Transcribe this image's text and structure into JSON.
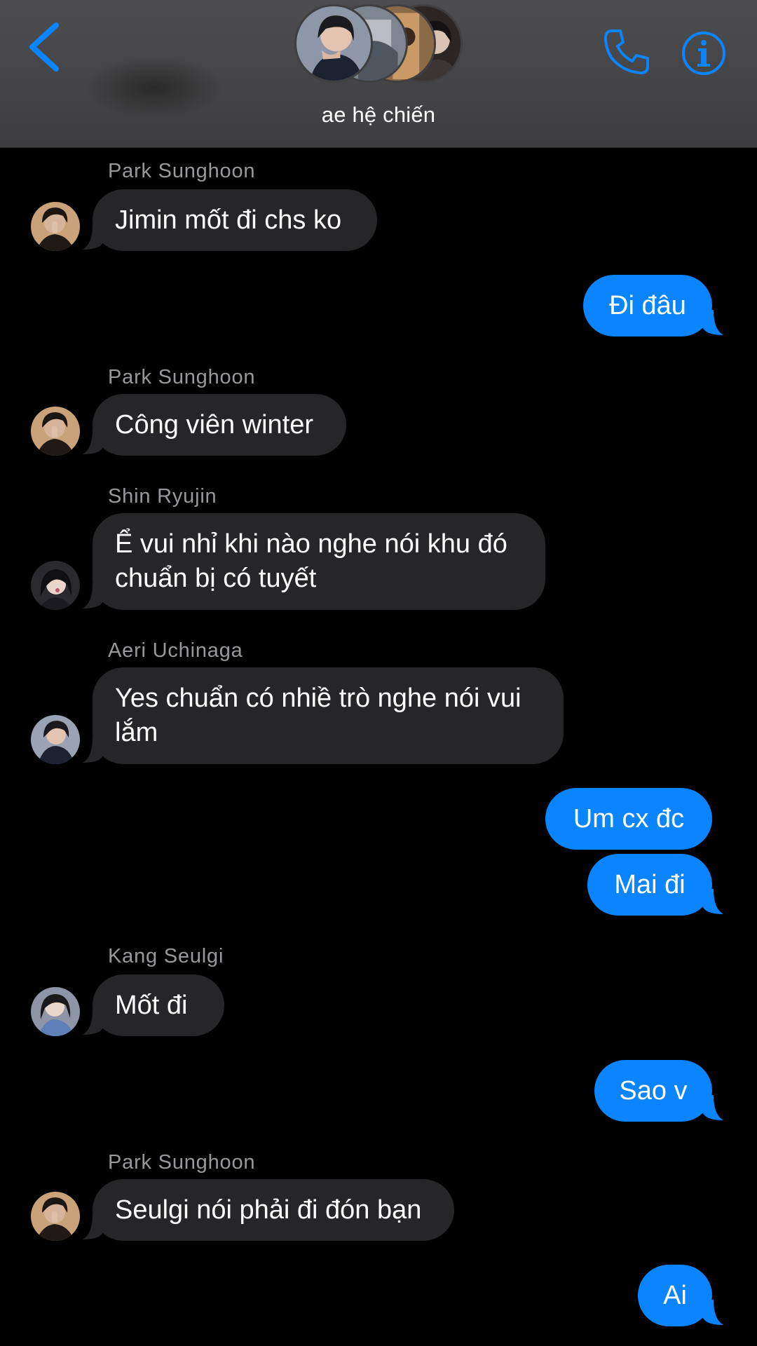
{
  "header": {
    "title": "ae hệ chiến",
    "back_icon": "chevron-left-icon",
    "call_icon": "phone-icon",
    "info_icon": "info-icon",
    "accent_color": "#0a84ff"
  },
  "colors": {
    "background": "#000000",
    "incoming_bubble": "#262629",
    "outgoing_bubble": "#0a84ff",
    "sender_name": "#98989d",
    "header_bg": "#454547"
  },
  "messages": [
    {
      "direction": "incoming",
      "sender": "Park Sunghoon",
      "text": "Jimin mốt đi chs ko"
    },
    {
      "direction": "outgoing",
      "text": "Đi đâu"
    },
    {
      "direction": "incoming",
      "sender": "Park Sunghoon",
      "text": "Công viên winter"
    },
    {
      "direction": "incoming",
      "sender": "Shin Ryujin",
      "text": "Ể vui nhỉ khi nào nghe nói khu đó chuẩn bị có tuyết"
    },
    {
      "direction": "incoming",
      "sender": "Aeri Uchinaga",
      "text": "Yes chuẩn có nhiề trò nghe nói vui lắm"
    },
    {
      "direction": "outgoing",
      "text": "Um cx đc"
    },
    {
      "direction": "outgoing",
      "text": "Mai đi"
    },
    {
      "direction": "incoming",
      "sender": "Kang Seulgi",
      "text": "Mốt đi"
    },
    {
      "direction": "outgoing",
      "text": "Sao v"
    },
    {
      "direction": "incoming",
      "sender": "Park Sunghoon",
      "text": "Seulgi nói phải đi đón bạn"
    },
    {
      "direction": "outgoing",
      "text": "Ai"
    }
  ]
}
